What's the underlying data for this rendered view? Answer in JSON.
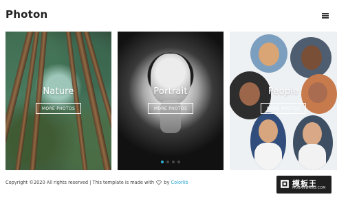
{
  "brand": "Photon",
  "cards": [
    {
      "title": "Nature",
      "button": "MORE PHOTOS"
    },
    {
      "title": "Portrait",
      "button": "MORE PHOTOS"
    },
    {
      "title": "People",
      "button": "MORE PHOTOS"
    }
  ],
  "pagination": {
    "active_index": 0,
    "count": 4
  },
  "footer": {
    "text_start": "Copyright ©2020 All rights reserved | This template is made with",
    "by": "by",
    "link": "Colorlib"
  },
  "watermark": {
    "main": "模板王",
    "sub": "MOBANWANG.COM"
  },
  "colors": {
    "accent": "#2ab7d8",
    "link": "#2ca6d5"
  },
  "icons": {
    "menu": "menu-icon",
    "heart": "heart-icon"
  }
}
